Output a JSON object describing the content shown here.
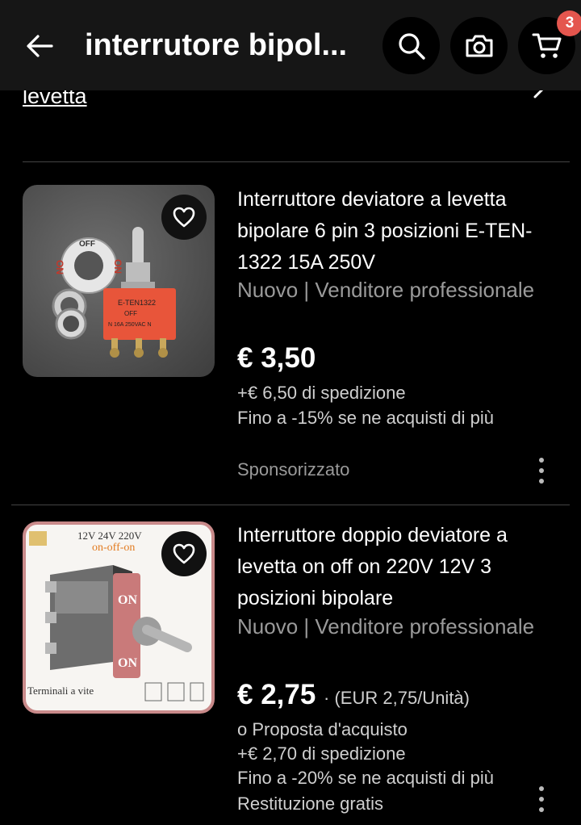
{
  "header": {
    "search_query": "interrutore bipol...",
    "cart_count": "3",
    "icons": [
      "back-arrow-icon",
      "search-icon",
      "camera-icon",
      "cart-icon"
    ]
  },
  "previous": {
    "link_text": "levetta"
  },
  "listings": [
    {
      "title": "Interruttore deviatore a levetta bipolare 6 pin 3 posizioni E-TEN-1322 15A 250V",
      "condition": "Nuovo | Venditore professionale",
      "price": "€ 3,50",
      "shipping": "+€ 6,50 di spedizione",
      "discount": "Fino a -15% se ne acquisti di più",
      "sponsored": "Sponsorizzato",
      "image_text": [
        "E-TEN1322",
        "OFF",
        "ON",
        "N 16A 250VAC N"
      ]
    },
    {
      "title": "Interruttore doppio deviatore a levetta on off on 220V 12V 3 posizioni bipolare",
      "condition": "Nuovo | Venditore professionale",
      "price": "€ 2,75",
      "unit_price": "· (EUR 2,75/Unità)",
      "offer": "o Proposta d'acquisto",
      "shipping": "+€ 2,70 di spedizione",
      "discount": "Fino a -20% se ne acquisti di più",
      "returns": "Restituzione gratis",
      "image_text": {
        "voltage": "12V 24V 220V",
        "mode": "on-off-on",
        "terminals": "Terminali a vite",
        "on_label": "ON"
      }
    }
  ]
}
